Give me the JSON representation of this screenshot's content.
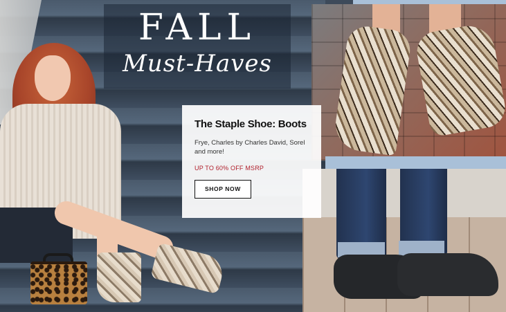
{
  "hero": {
    "title": "FALL",
    "subtitle": "Must-Haves"
  },
  "promo": {
    "heading": "The Staple Shoe: Boots",
    "description": "Frye, Charles by Charles David, Sorel and more!",
    "sale_text": "UP TO 60% OFF MSRP",
    "cta_label": "SHOP NOW"
  },
  "colors": {
    "sale_red": "#b01e2a",
    "divider_blue": "#a9c0d8",
    "stairs_slate": "#3f4e60"
  }
}
